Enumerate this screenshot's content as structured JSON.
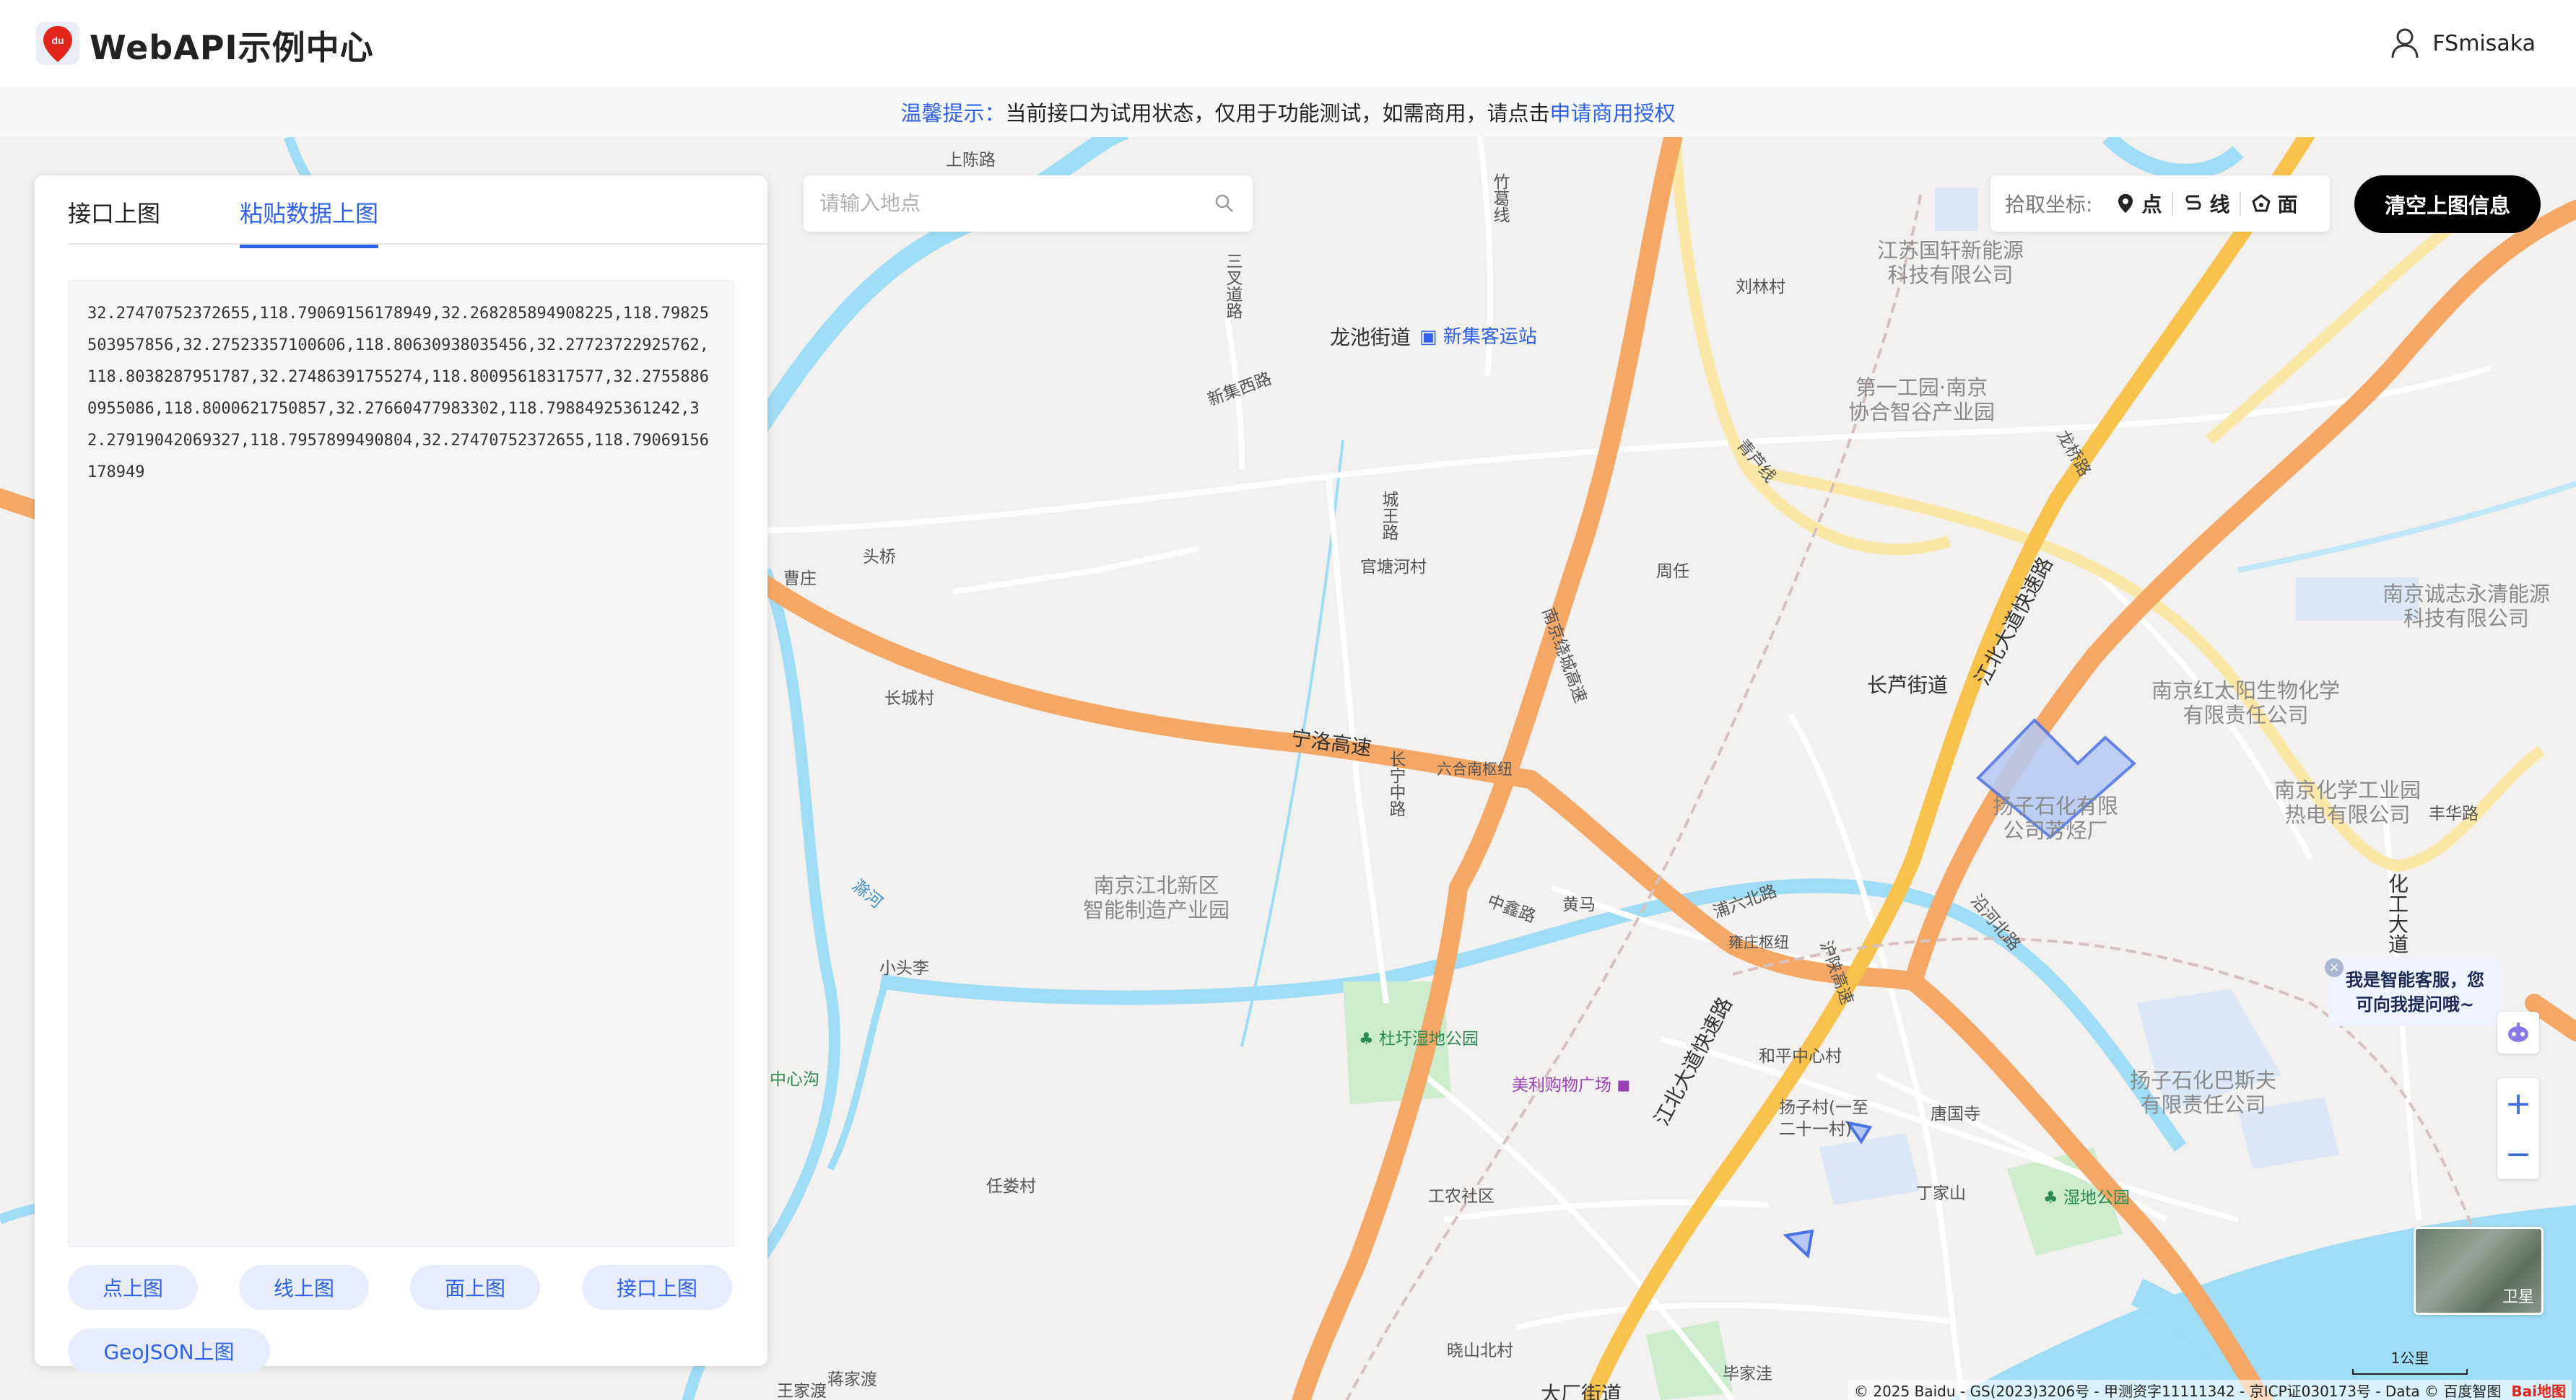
{
  "header": {
    "title": "WebAPI示例中心",
    "username": "FSmisaka"
  },
  "notice": {
    "label": "温馨提示：",
    "text": "当前接口为试用状态，仅用于功能测试，如需商用，请点击",
    "link": "申请商用授权"
  },
  "panel": {
    "tabs": [
      {
        "label": "接口上图",
        "active": false
      },
      {
        "label": "粘贴数据上图",
        "active": true
      }
    ],
    "data": "32.27470752372655,118.79069156178949,32.268285894908225,118.79825503957856,32.27523357100606,118.80630938035456,32.27723722925762,118.8038287951787,32.27486391755274,118.80095618317577,32.27558860955086,118.8000621750857,32.27660477983302,118.79884925361242,32.27919042069327,118.7957899490804,32.27470752372655,118.79069156178949",
    "buttons": {
      "point": "点上图",
      "line": "线上图",
      "polygon": "面上图",
      "api": "接口上图",
      "geojson": "GeoJSON上图"
    }
  },
  "search": {
    "placeholder": "请输入地点"
  },
  "picker": {
    "label": "拾取坐标:",
    "point": "点",
    "line": "线",
    "polygon": "面"
  },
  "clear_button": "清空上图信息",
  "assistant": {
    "line1": "我是智能客服，您",
    "line2": "可向我提问哦~"
  },
  "zoom": {
    "in": "+",
    "out": "−"
  },
  "satellite_label": "卫星",
  "scale_label": "1公里",
  "copyright": "© 2025 Baidu - GS(2023)3206号 - 甲测资字11111342 - 京ICP证030173号 - Data © 百度智图",
  "baidu_logo": "Bai地图",
  "map_labels": {
    "shangchen": "上陈路",
    "zhugexian": "竹葛线",
    "jiangsuguoxuan": "江苏国轩新能源\n科技有限公司",
    "liulincun": "刘林村",
    "longchi": "龙池街道",
    "xinji_station": "新集客运站",
    "sanchadao": "三叉道路",
    "xinjixi": "新集西路",
    "diyigongyuan": "第一工园·南京\n协合智谷产业园",
    "qinglu": "青芦线",
    "longtan": "龙桥路",
    "toutao": "头桥",
    "caozhuang": "曹庄",
    "chengwang": "城王路",
    "guantanghe": "官塘河村",
    "zhouren": "周任",
    "nanjingrao": "南京绕城高速",
    "changlu": "长芦街道",
    "nanjinghongtai": "南京红太阳生物化学\n有限责任公司",
    "nanjingchengzhi": "南京诚志永清能源\n科技有限公司",
    "changcheng": "长城村",
    "ningluo": "宁洛高速",
    "liuhe": "六合南枢纽",
    "changning": "长宁中路",
    "yangzi": "扬子石化有限\n公司芳烃厂",
    "nanjinghuaxue": "南京化学工业园\n热电有限公司",
    "fenghua": "丰华路",
    "jiangbei_park": "南京江北新区\n智能制造产业园",
    "huangma": "黄马",
    "puliu": "浦六北路",
    "zhongxin": "中鑫路",
    "yongzhuang": "雍庄枢纽",
    "huojiang": "沪陕高速",
    "yanghebei": "沿河北路",
    "huagong": "化工大道",
    "xiaotou": "小头李",
    "dushan": "杜圩湿地公园",
    "meili": "美利购物广场",
    "hepingzhongxin": "和平中心村",
    "yangzi_basf": "扬子石化巴斯夫\n有限责任公司",
    "yangzicun": "扬子村(一至\n二十一村)",
    "tangguo": "唐国寺",
    "renlou": "任娄村",
    "gongnong": "工农社区",
    "dingjiashan": "丁家山",
    "shidi": "湿地公园",
    "xiaoshan": "晓山北村",
    "bijia": "毕家洼",
    "jiangjia": "蒋家渡",
    "wangjia": "王家渡",
    "dachang": "大厂街道",
    "jiangbei_ave": "江北大道快速路",
    "chenghe": "滁河",
    "zhongxingou": "中心沟"
  }
}
